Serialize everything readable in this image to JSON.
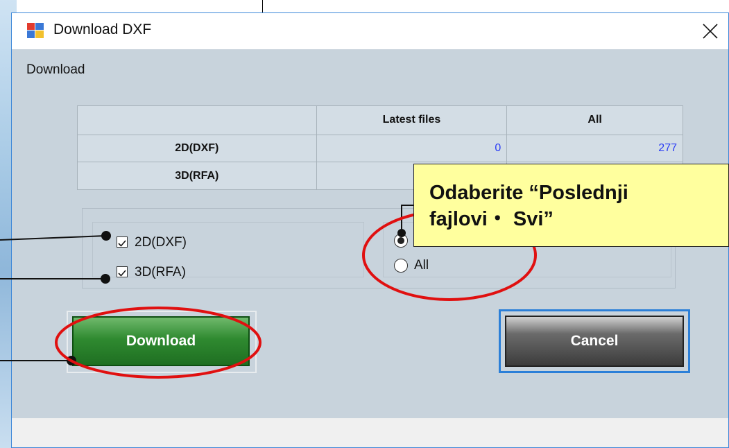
{
  "window": {
    "title": "Download DXF",
    "group_label": "Download"
  },
  "table": {
    "headers": [
      "",
      "Latest files",
      "All"
    ],
    "rows": [
      {
        "label": "2D(DXF)",
        "latest": "0",
        "all": "277"
      },
      {
        "label": "3D(RFA)",
        "latest": "",
        "all": ""
      }
    ]
  },
  "options": {
    "checkbox_2d": {
      "label": "2D(DXF)",
      "checked": true
    },
    "checkbox_3d": {
      "label": "3D(RFA)",
      "checked": true
    },
    "radio_latest": {
      "selected": true
    },
    "radio_all": {
      "label": "All",
      "selected": false
    }
  },
  "buttons": {
    "download": "Download",
    "cancel": "Cancel"
  },
  "callout": {
    "line1": "Odaberite “Poslednji",
    "line2": "fajlovi・ Svi”"
  },
  "colors": {
    "dialog_bg": "#c8d3dc",
    "download_green": "#2f8a30",
    "cancel_gray": "#4a4a4a",
    "highlight_red": "#e01010",
    "callout_yellow": "#ffff9e",
    "number_blue": "#2a3cf5"
  },
  "icons": {
    "app": "window-app-icon",
    "close": "close-icon"
  }
}
